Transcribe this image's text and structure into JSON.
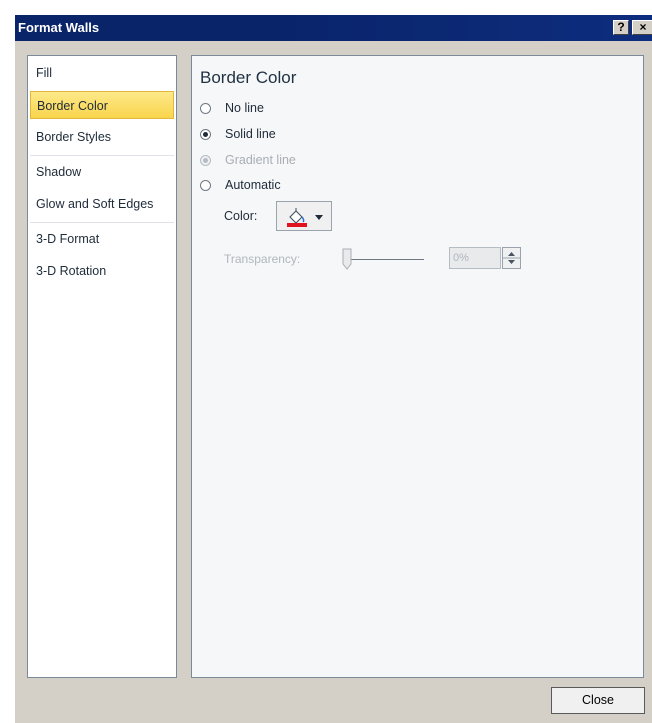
{
  "window": {
    "title": "Format Walls",
    "help_label": "?",
    "close_label": "×"
  },
  "nav": {
    "items": [
      {
        "label": "Fill"
      },
      {
        "label": "Border Color"
      },
      {
        "label": "Border Styles"
      },
      {
        "label": "Shadow"
      },
      {
        "label": "Glow and Soft Edges"
      },
      {
        "label": "3-D Format"
      },
      {
        "label": "3-D Rotation"
      }
    ],
    "selected": "Border Color"
  },
  "border_color": {
    "title": "Border Color",
    "options": [
      {
        "label": "No line",
        "checked": false,
        "enabled": true
      },
      {
        "label": "Solid line",
        "checked": true,
        "enabled": true
      },
      {
        "label": "Gradient line",
        "checked": false,
        "enabled": false
      },
      {
        "label": "Automatic",
        "checked": false,
        "enabled": true
      }
    ],
    "color_label": "Color:",
    "current_color": "#e0141e",
    "transparency_label": "Transparency:",
    "transparency_value": "0%",
    "transparency_percent": 0
  },
  "footer": {
    "close_button": "Close"
  }
}
